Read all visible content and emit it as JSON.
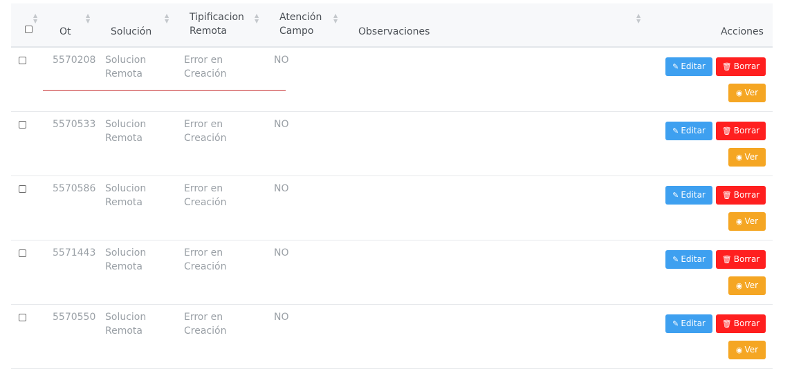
{
  "header": {
    "columns": [
      "Ot",
      "Solución",
      "Tipificacion Remota",
      "Atención Campo",
      "Observaciones",
      "Acciones"
    ],
    "tipificacion_line1": "Tipificacion",
    "tipificacion_line2": "Remota",
    "atencion_line1": "Atención",
    "atencion_line2": "Campo"
  },
  "actions": {
    "edit_label": "Editar",
    "delete_label": "Borrar",
    "view_label": "Ver"
  },
  "rows": [
    {
      "ot": "5570208",
      "solucion_1": "Solucion",
      "solucion_2": "Remota",
      "tip_1": "Error en",
      "tip_2": "Creación",
      "atencion": "NO",
      "observaciones": ""
    },
    {
      "ot": "5570533",
      "solucion_1": "Solucion",
      "solucion_2": "Remota",
      "tip_1": "Error en",
      "tip_2": "Creación",
      "atencion": "NO",
      "observaciones": ""
    },
    {
      "ot": "5570586",
      "solucion_1": "Solucion",
      "solucion_2": "Remota",
      "tip_1": "Error en",
      "tip_2": "Creación",
      "atencion": "NO",
      "observaciones": ""
    },
    {
      "ot": "5571443",
      "solucion_1": "Solucion",
      "solucion_2": "Remota",
      "tip_1": "Error en",
      "tip_2": "Creación",
      "atencion": "NO",
      "observaciones": ""
    },
    {
      "ot": "5570550",
      "solucion_1": "Solucion",
      "solucion_2": "Remota",
      "tip_1": "Error en",
      "tip_2": "Creación",
      "atencion": "NO",
      "observaciones": ""
    }
  ],
  "colors": {
    "edit": "#3ea0f0",
    "delete": "#ff1f1f",
    "view": "#f5a623",
    "underline": "#c6282a"
  },
  "icons": {
    "edit": "edit-icon",
    "delete": "trash-icon",
    "view": "eye-icon",
    "sort": "sort-icon"
  }
}
